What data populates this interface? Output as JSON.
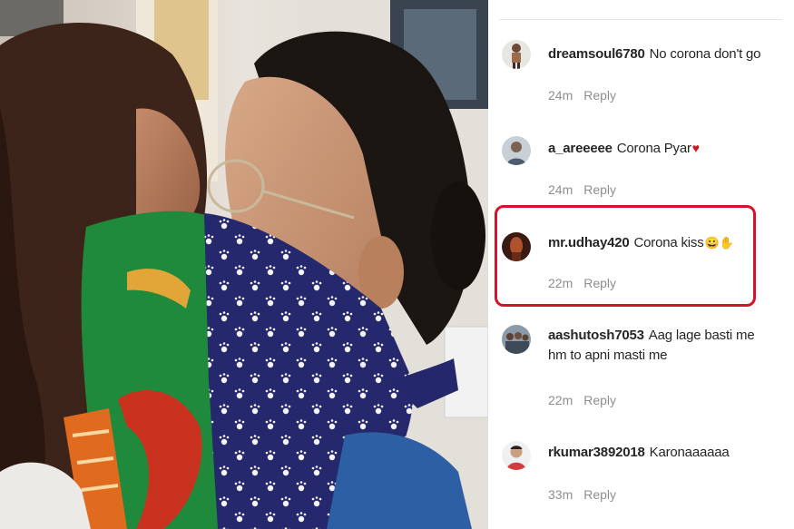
{
  "comments": [
    {
      "username": "dreamsoul6780",
      "text": "No corona don't go",
      "emoji": "",
      "time": "24m",
      "reply": "Reply",
      "avatar_icon": "child-portrait-avatar"
    },
    {
      "username": "a_areeeee",
      "text": "Corona Pyar",
      "emoji": "♥",
      "time": "24m",
      "reply": "Reply",
      "avatar_icon": "person-portrait-avatar"
    },
    {
      "username": "mr.udhay420",
      "text": "Corona kiss",
      "emoji": "😀✋",
      "time": "22m",
      "reply": "Reply",
      "avatar_icon": "dark-portrait-avatar"
    },
    {
      "username": "aashutosh7053",
      "text": "Aag lage basti me hm to apni masti me",
      "emoji": "",
      "time": "22m",
      "reply": "Reply",
      "avatar_icon": "group-portrait-avatar"
    },
    {
      "username": "rkumar3892018",
      "text": "Karonaaaaaa",
      "emoji": "",
      "time": "33m",
      "reply": "Reply",
      "avatar_icon": "man-portrait-avatar"
    }
  ],
  "highlight": {
    "comment": "mr.udhay420",
    "color": "#d2142a"
  },
  "colors": {
    "username": "#262626",
    "meta": "#8e8e8e",
    "heart": "#d0141f",
    "green_mask": "#1f8a3c",
    "blue_mask": "#24276b"
  }
}
